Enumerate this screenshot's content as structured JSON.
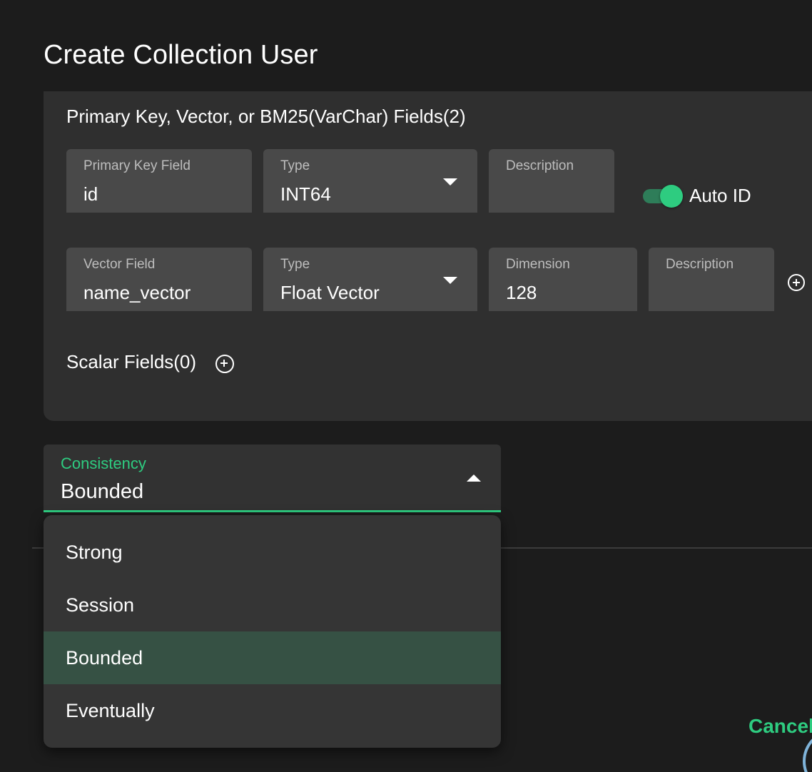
{
  "dialog": {
    "title": "Create Collection User"
  },
  "panel": {
    "title": "Primary Key, Vector, or BM25(VarChar) Fields(2)",
    "primary_key_row": {
      "name_label": "Primary Key Field",
      "name_value": "id",
      "type_label": "Type",
      "type_value": "INT64",
      "description_label": "Description",
      "description_value": "",
      "auto_id_label": "Auto ID",
      "auto_id_enabled": true
    },
    "vector_row": {
      "name_label": "Vector Field",
      "name_value": "name_vector",
      "type_label": "Type",
      "type_value": "Float Vector",
      "dimension_label": "Dimension",
      "dimension_value": "128",
      "description_label": "Description",
      "description_value": ""
    },
    "scalar_fields_label": "Scalar Fields(0)"
  },
  "consistency": {
    "label": "Consistency",
    "value": "Bounded",
    "options": [
      {
        "label": "Strong",
        "selected": false
      },
      {
        "label": "Session",
        "selected": false
      },
      {
        "label": "Bounded",
        "selected": true
      },
      {
        "label": "Eventually",
        "selected": false
      }
    ]
  },
  "footer": {
    "cancel_label": "Cancel"
  },
  "colors": {
    "accent": "#2ecc80",
    "background": "#1c1c1c",
    "panel": "#2f2f2f",
    "field": "#494949",
    "selected_option": "#365144"
  },
  "icons": {
    "dropdown_closed": "caret-down-icon",
    "dropdown_open": "caret-up-icon",
    "add": "plus-circle-icon"
  }
}
